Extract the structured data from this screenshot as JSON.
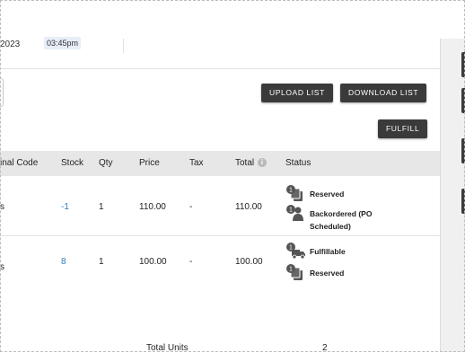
{
  "header": {
    "date_fragment": "2023",
    "time": "03:45pm"
  },
  "actions": {
    "upload_label": "UPLOAD LIST",
    "download_label": "DOWNLOAD LIST",
    "fulfill_label": "FULFILL"
  },
  "table": {
    "columns": {
      "code": "inal Code",
      "stock": "Stock",
      "qty": "Qty",
      "price": "Price",
      "tax": "Tax",
      "total": "Total",
      "status": "Status"
    },
    "rows": [
      {
        "code": "s",
        "stock": "-1",
        "qty": "1",
        "price": "110.00",
        "tax": "-",
        "total": "110.00",
        "statuses": [
          {
            "count": "1",
            "label": "Reserved",
            "icon": "reserved-stack-icon"
          },
          {
            "count": "1",
            "label": "Backordered (PO Scheduled)",
            "icon": "backorder-person-icon"
          }
        ]
      },
      {
        "code": "s",
        "stock": "8",
        "qty": "1",
        "price": "100.00",
        "tax": "-",
        "total": "100.00",
        "statuses": [
          {
            "count": "1",
            "label": "Fulfillable",
            "icon": "delivery-truck-icon"
          },
          {
            "count": "1",
            "label": "Reserved",
            "icon": "reserved-stack-icon"
          }
        ]
      }
    ],
    "footer": {
      "label": "Total Units",
      "value": "2"
    }
  },
  "colors": {
    "button_bg": "#3a3a3a",
    "link": "#2a7ab8",
    "header_bg": "#e7e7e7"
  }
}
